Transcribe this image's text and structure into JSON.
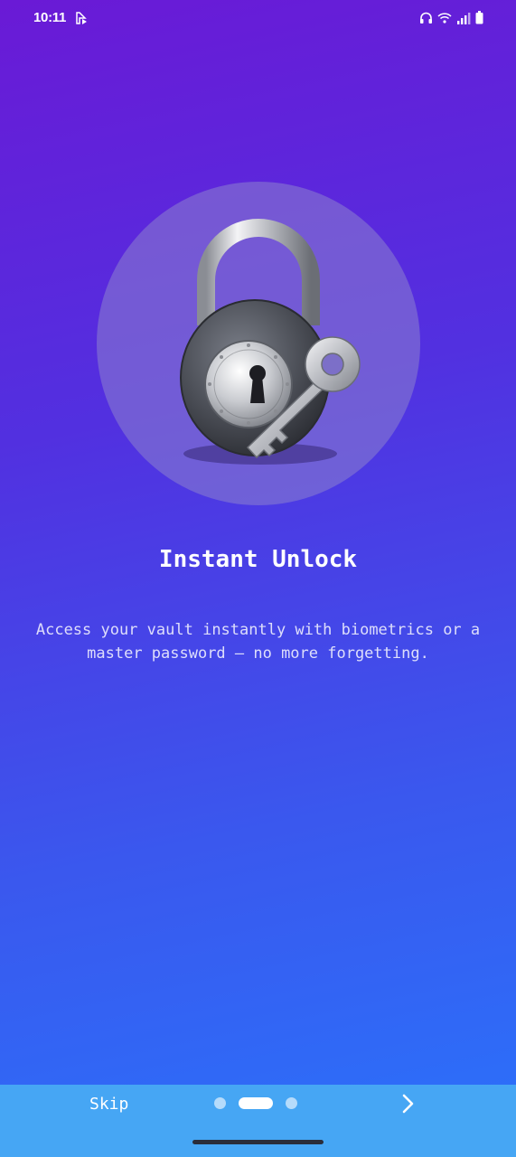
{
  "status_bar": {
    "time": "10:11",
    "icons": [
      "notification-icon",
      "headphones-icon",
      "wifi-icon",
      "signal-icon",
      "battery-icon"
    ]
  },
  "onboarding": {
    "illustration": "padlock-with-key",
    "title": "Instant Unlock",
    "description": "Access your vault instantly with biometrics or a master password — no more forgetting.",
    "page_count": 3,
    "current_page": 2
  },
  "footer": {
    "skip_label": "Skip",
    "next_icon": "chevron-right-icon"
  },
  "colors": {
    "gradient_top": "#6a1ad6",
    "gradient_bottom": "#2a72fb",
    "bottom_bar": "#46a6f4",
    "text": "#ffffff"
  }
}
